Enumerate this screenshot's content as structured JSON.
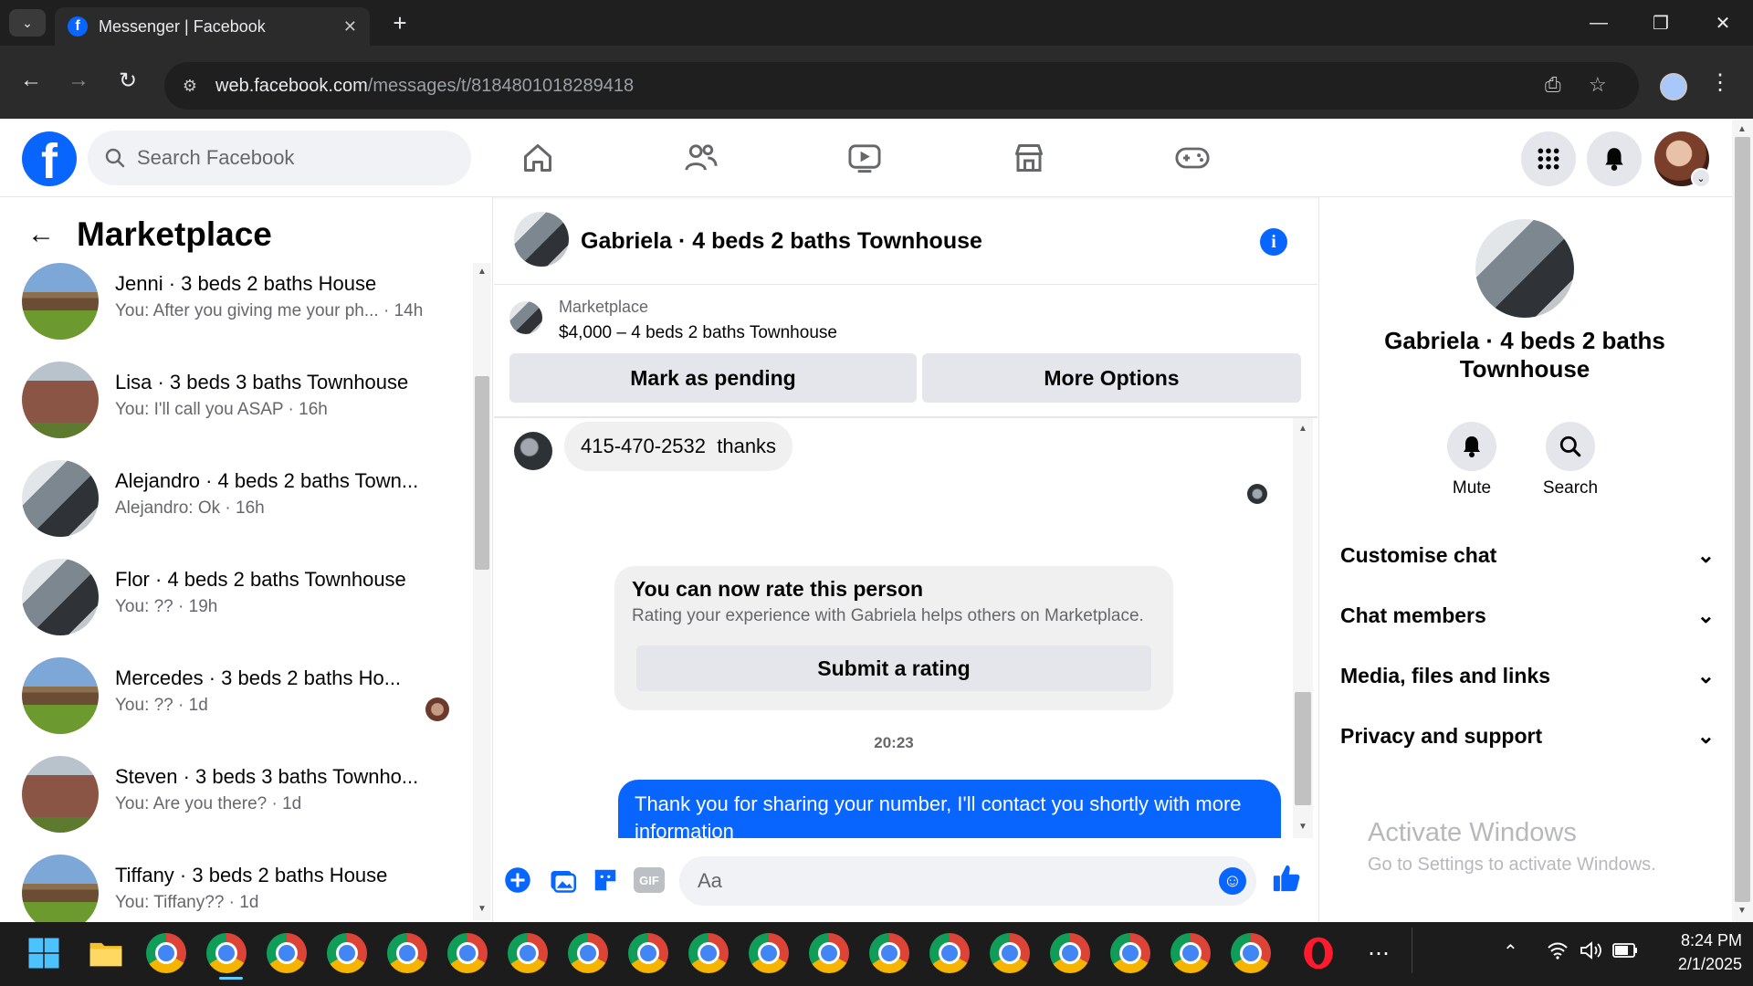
{
  "browser": {
    "tab_title": "Messenger | Facebook",
    "url_host": "web.facebook.com",
    "url_path": "/messages/t/8184801018289418"
  },
  "fb": {
    "search_placeholder": "Search Facebook"
  },
  "left": {
    "title": "Marketplace",
    "conversations": [
      {
        "name": "Jenni · 3 beds 2 baths House",
        "preview": "You: After you giving me your ph...",
        "time": "· 14h"
      },
      {
        "name": "Lisa · 3 beds 3 baths Townhouse",
        "preview": "You: I'll call you ASAP",
        "time": "· 16h"
      },
      {
        "name": "Alejandro · 4 beds 2 baths Town...",
        "preview": "Alejandro: Ok",
        "time": "· 16h"
      },
      {
        "name": "Flor · 4 beds 2 baths Townhouse",
        "preview": "You: ??",
        "time": "· 19h"
      },
      {
        "name": "Mercedes · 3 beds 2 baths Ho...",
        "preview": "You: ??",
        "time": "· 1d"
      },
      {
        "name": "Steven · 3 beds 3 baths Townho...",
        "preview": "You: Are you there?",
        "time": "· 1d"
      },
      {
        "name": "Tiffany · 3 beds 2 baths House",
        "preview": "You: Tiffany??",
        "time": "· 1d"
      }
    ]
  },
  "chat": {
    "title": "Gabriela · 4 beds 2 baths Townhouse",
    "marketplace_label": "Marketplace",
    "listing": "$4,000 – 4 beds 2 baths Townhouse",
    "mark_pending": "Mark as pending",
    "more_options": "More Options",
    "incoming_message": "415-470-2532  thanks",
    "rate_title": "You can now rate this person",
    "rate_desc": "Rating your experience with Gabriela helps others on Marketplace.",
    "rate_button": "Submit a rating",
    "timestamp": "20:23",
    "outgoing_message": "Thank you for sharing your number, I'll contact you shortly with more information",
    "composer_placeholder": "Aa",
    "gif_label": "GIF"
  },
  "right": {
    "name": "Gabriela · 4 beds 2 baths Townhouse",
    "mute_label": "Mute",
    "search_label": "Search",
    "sections": [
      "Customise chat",
      "Chat members",
      "Media, files and links",
      "Privacy and support"
    ],
    "watermark_title": "Activate Windows",
    "watermark_sub": "Go to Settings to activate Windows."
  },
  "taskbar": {
    "time": "8:24 PM",
    "date": "2/1/2025"
  },
  "colors": {
    "fb_blue": "#0866ff",
    "chrome_dark": "#1f1f1f",
    "bubble_grey": "#f0f0f0"
  }
}
